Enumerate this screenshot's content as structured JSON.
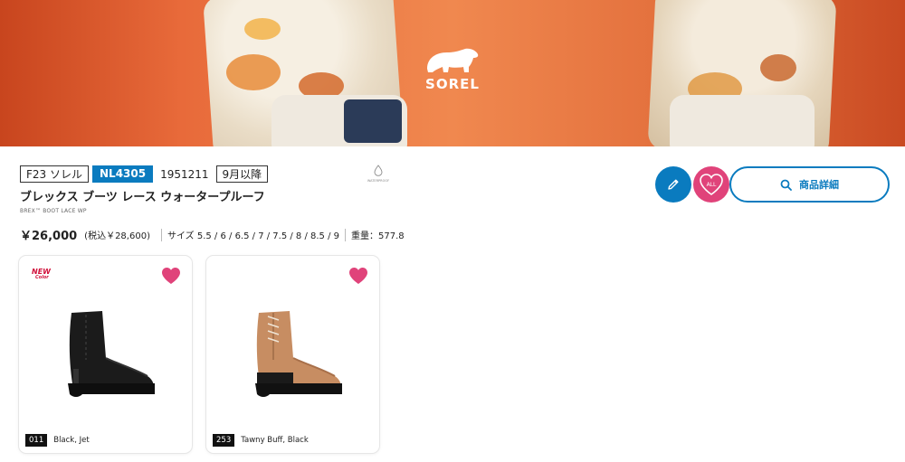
{
  "banner": {
    "brand": "SOREL"
  },
  "product": {
    "season_tag": "F23 ソレル",
    "model_code": "NL4305",
    "item_number": "1951211",
    "availability": "9月以降",
    "name_ja": "ブレックス ブーツ レース ウォータープルーフ",
    "name_en": "BREX™ BOOT LACE WP",
    "price": "￥26,000",
    "price_tax": "(税込￥28,600)",
    "sizes": "サイズ 5.5 / 6 / 6.5 / 7 / 7.5 / 8 / 8.5 / 9",
    "weight": "重量：577.8",
    "feature_label": "WATERPROOF",
    "feature_icon": "water-drop-icon"
  },
  "actions": {
    "edit_icon": "pencil-icon",
    "fav_all_label": "ALL",
    "detail_label": "商品詳細",
    "detail_icon": "search-icon"
  },
  "colors": [
    {
      "code": "011",
      "name": "Black, Jet",
      "badge_line1": "NEW",
      "badge_line2": "Color"
    },
    {
      "code": "253",
      "name": "Tawny Buff, Black"
    }
  ],
  "theme": {
    "primary": "#0a7bbf",
    "favorite": "#e0437a",
    "new_badge": "#d0103a"
  }
}
